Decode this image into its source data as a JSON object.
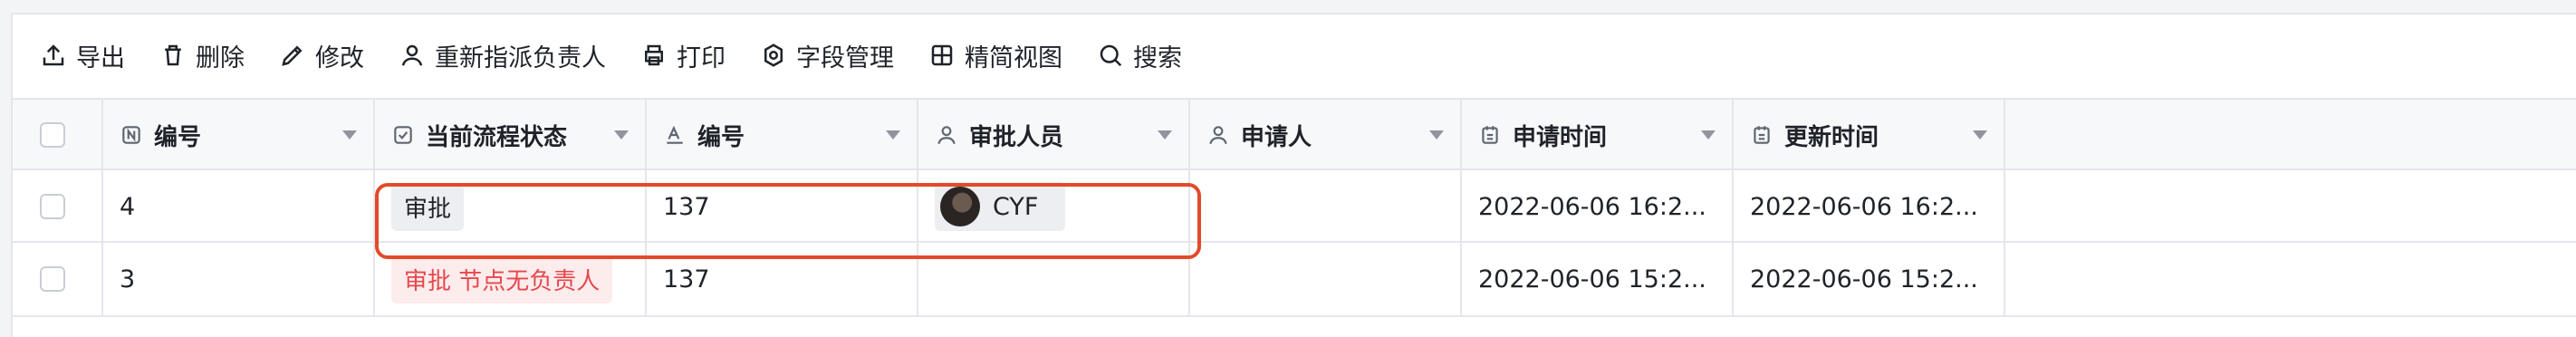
{
  "toolbar": {
    "export": "导出",
    "delete": "删除",
    "edit": "修改",
    "reassign": "重新指派负责人",
    "print": "打印",
    "fields": "字段管理",
    "compact_view": "精简视图",
    "search": "搜索"
  },
  "columns": [
    "编号",
    "当前流程状态",
    "编号",
    "审批人员",
    "申请人",
    "申请时间",
    "更新时间"
  ],
  "rows": [
    {
      "id": "4",
      "status": "审批",
      "number": "137",
      "approver": "CYF",
      "applicant": "",
      "apply_time": "2022-06-06 16:2...",
      "update_time": "2022-06-06 16:2..."
    },
    {
      "id": "3",
      "status": "审批 节点无负责人",
      "number": "137",
      "approver": "",
      "applicant": "",
      "apply_time": "2022-06-06 15:2...",
      "update_time": "2022-06-06 15:2..."
    }
  ],
  "colors": {
    "highlight": "#e24a2b",
    "warning_text": "#e5484d",
    "warning_bg": "#fdecec"
  }
}
